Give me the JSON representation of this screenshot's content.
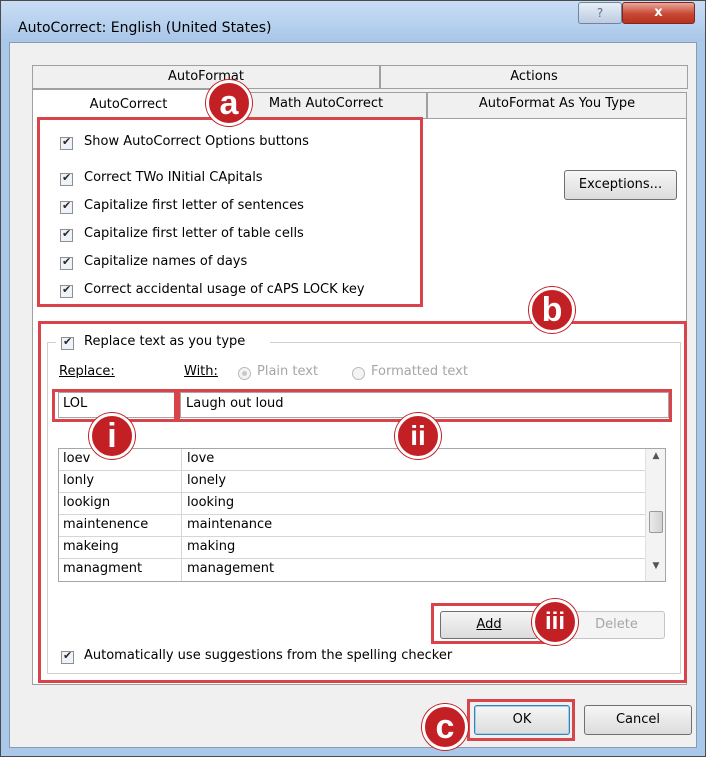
{
  "window": {
    "title": "AutoCorrect: English (United States)"
  },
  "titlebar_buttons": {
    "help": "?",
    "close": "x"
  },
  "tabs": {
    "row1": [
      "AutoFormat",
      "Actions"
    ],
    "row2": [
      "AutoCorrect",
      "Math AutoCorrect",
      "AutoFormat As You Type"
    ]
  },
  "options": {
    "show_buttons": {
      "text": "Show AutoCorrect Options buttons",
      "checked": true
    },
    "two_initial": {
      "text": "Correct TWo INitial CApitals",
      "checked": true
    },
    "first_letter": {
      "text": "Capitalize first letter of sentences",
      "checked": true
    },
    "table_cells": {
      "text": "Capitalize first letter of table cells",
      "checked": true
    },
    "names_days": {
      "text": "Capitalize names of days",
      "checked": true
    },
    "caps_lock": {
      "text": "Correct accidental usage of cAPS LOCK key",
      "checked": true
    }
  },
  "exceptions_button": "Exceptions...",
  "replace_section": {
    "toggle_label": "Replace text as you type",
    "replace_label": "Replace:",
    "with_label": "With:",
    "plain_text": "Plain text",
    "formatted_text": "Formatted text",
    "replace_value": "LOL",
    "with_value": "Laugh out loud",
    "entries": [
      {
        "from": "loev",
        "to": "love"
      },
      {
        "from": "lonly",
        "to": "lonely"
      },
      {
        "from": "lookign",
        "to": "looking"
      },
      {
        "from": "maintenence",
        "to": "maintenance"
      },
      {
        "from": "makeing",
        "to": "making"
      },
      {
        "from": "managment",
        "to": "management"
      }
    ],
    "add_button": "Add",
    "delete_button": "Delete",
    "spelling_label": "Automatically use suggestions from the spelling checker"
  },
  "buttons": {
    "ok": "OK",
    "cancel": "Cancel"
  },
  "annotations": {
    "a": "a",
    "b": "b",
    "c": "c",
    "i": "i",
    "ii": "ii",
    "iii": "iii"
  },
  "colors": {
    "annotation_red": "#d9434a",
    "marker_fill": "#c32026"
  }
}
